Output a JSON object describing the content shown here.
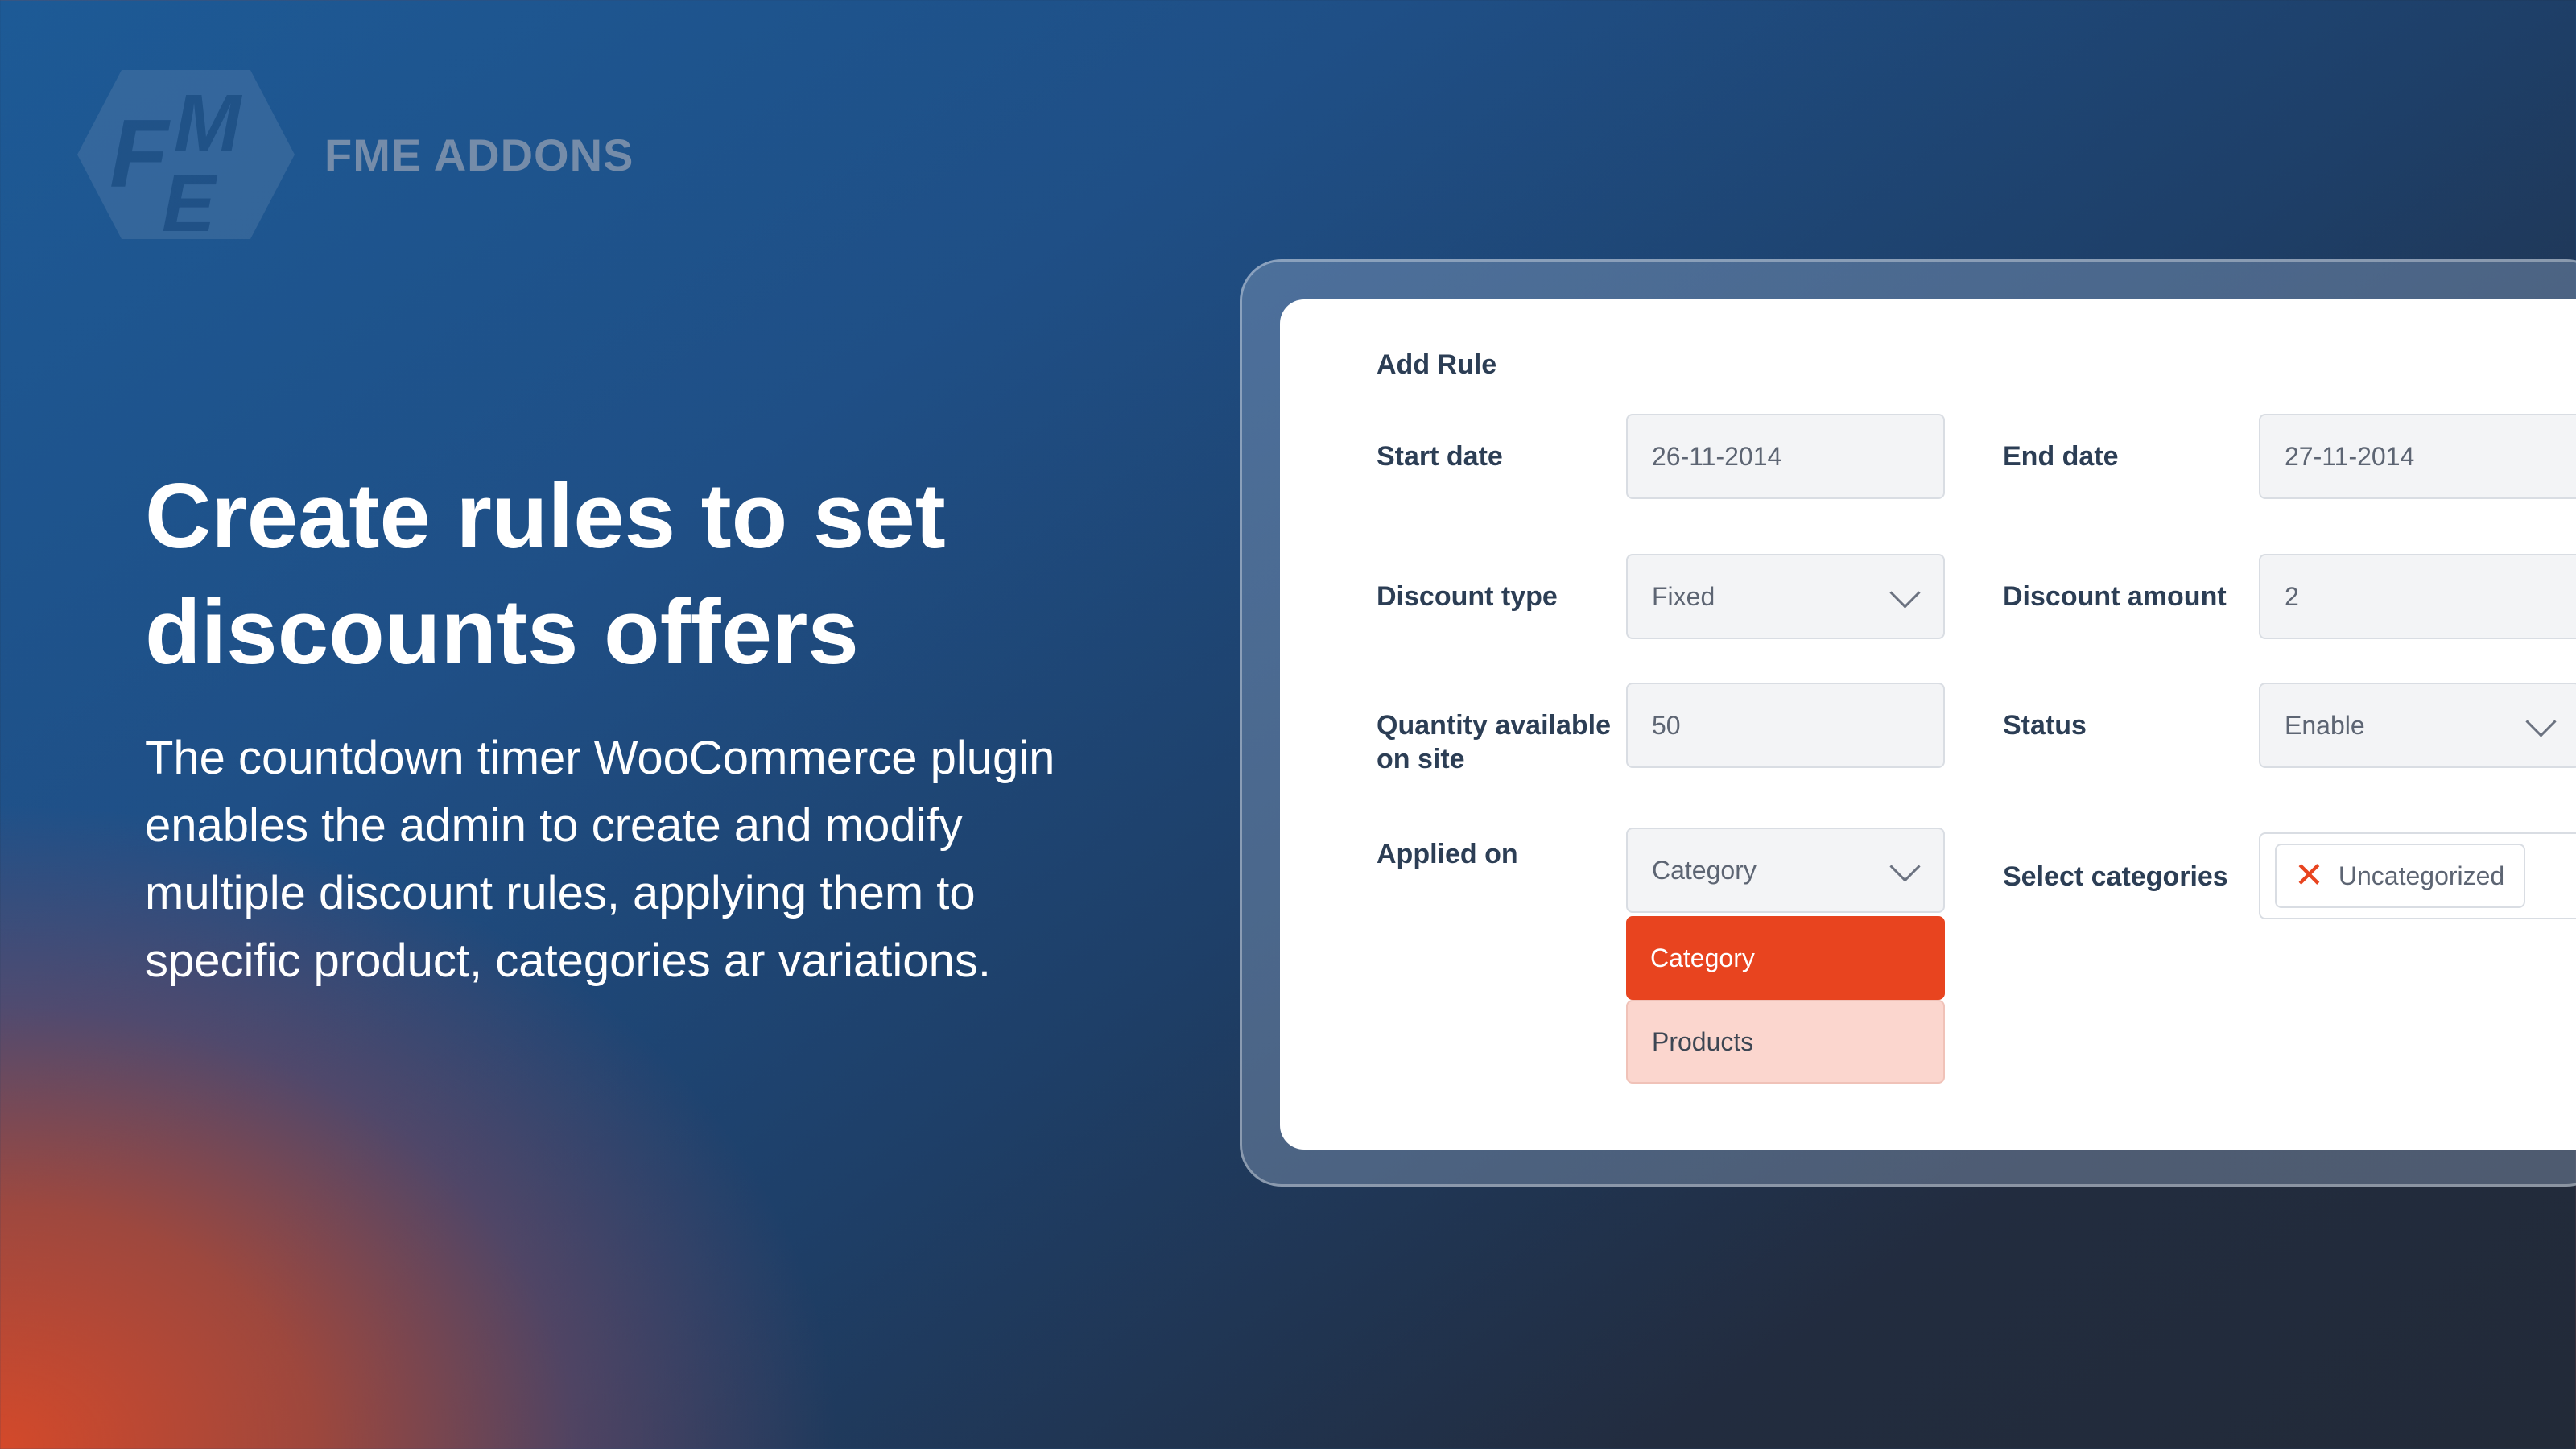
{
  "brand": {
    "name": "FME ADDONS",
    "logo_letters": "FME",
    "logo_icon": "fme-logo-icon"
  },
  "hero": {
    "headline_line1": "Create rules to set",
    "headline_line2": "discounts offers",
    "sub_line1": "The countdown timer WooCommerce plugin",
    "sub_line2": "enables the admin to create and modify",
    "sub_line3": "multiple discount rules, applying them to",
    "sub_line4": "specific product, categories ar variations."
  },
  "form": {
    "title": "Add Rule",
    "start_date": {
      "label": "Start date",
      "value": "26-11-2014"
    },
    "end_date": {
      "label": "End date",
      "value": "27-11-2014"
    },
    "discount_type": {
      "label": "Discount type",
      "value": "Fixed"
    },
    "discount_amount": {
      "label": "Discount amount",
      "value": "2"
    },
    "quantity": {
      "label_line1": "Quantity available",
      "label_line2": "on site",
      "value": "50"
    },
    "status": {
      "label": "Status",
      "value": "Enable"
    },
    "applied_on": {
      "label": "Applied on",
      "value": "Category",
      "options": [
        {
          "label": "Category",
          "selected": true
        },
        {
          "label": "Products",
          "selected": false
        }
      ]
    },
    "select_categories": {
      "label": "Select categories",
      "tags": [
        "Uncategorized"
      ],
      "remove_icon": "close-icon"
    }
  },
  "colors": {
    "accent": "#e8441f",
    "option_bg": "#fbd6ce",
    "label": "#2c3e55",
    "field_bg": "#f3f4f6",
    "headline": "#ffffff"
  }
}
